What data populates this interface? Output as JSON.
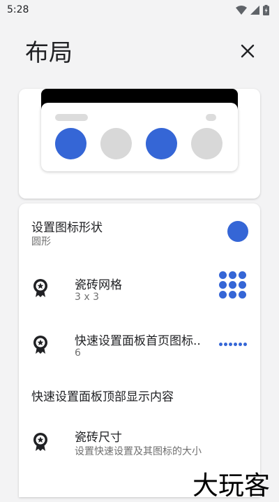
{
  "status_bar": {
    "time": "5:28"
  },
  "header": {
    "title": "布局"
  },
  "colors": {
    "accent": "#3566d6",
    "tile_off": "#d8d8d8"
  },
  "preview": {
    "tiles": [
      {
        "state": "on"
      },
      {
        "state": "off"
      },
      {
        "state": "on"
      },
      {
        "state": "off"
      }
    ]
  },
  "settings": {
    "icon_shape": {
      "title": "设置图标形状",
      "value": "圆形"
    },
    "tile_grid": {
      "title": "瓷砖网格",
      "value": "3 x 3"
    },
    "first_page_icons": {
      "title": "快速设置面板首页图标..",
      "value": "6"
    },
    "top_content": {
      "title": "快速设置面板顶部显示内容"
    },
    "tile_size": {
      "title": "瓷砖尺寸",
      "value": "设置快速设置及其图标的大小"
    }
  },
  "watermark": {
    "text": "大玩客"
  }
}
